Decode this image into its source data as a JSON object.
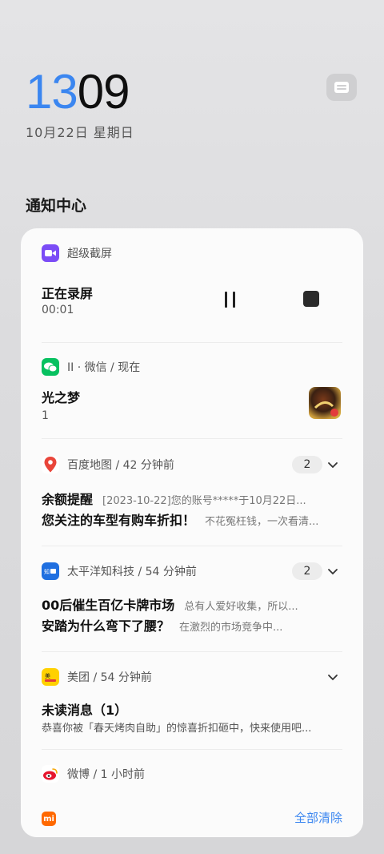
{
  "status": {
    "hour": "13",
    "minute": "09",
    "date": "10月22日 星期日"
  },
  "notification_center": {
    "title": "通知中心",
    "clear_all": "全部清除",
    "brand": "mi"
  },
  "screen_record": {
    "app": "超级截屏",
    "title": "正在录屏",
    "elapsed": "00:01"
  },
  "wechat": {
    "app": "II · 微信 / 现在",
    "title": "光之梦",
    "body": "1"
  },
  "baidu_map": {
    "app": "百度地图 / 42 分钟前",
    "count": "2",
    "items": [
      {
        "title": "余额提醒",
        "preview": "[2023-10-22]您的账号*****于10月22日..."
      },
      {
        "title": "您关注的车型有购车折扣！",
        "preview": "不花冤枉钱，一次看清..."
      }
    ]
  },
  "pconline": {
    "app": "太平洋知科技 / 54 分钟前",
    "count": "2",
    "items": [
      {
        "title": "00后催生百亿卡牌市场",
        "preview": "总有人爱好收集，所以..."
      },
      {
        "title": "安踏为什么弯下了腰？",
        "preview": "在激烈的市场竞争中..."
      }
    ]
  },
  "meituan": {
    "app": "美团 / 54 分钟前",
    "title": "未读消息（1）",
    "body": "恭喜你被「春天烤肉自助」的惊喜折扣砸中，快来使用吧..."
  },
  "weibo": {
    "app": "微博 / 1 小时前"
  },
  "colors": {
    "accent": "#3b86f0",
    "wechat_green": "#07c160",
    "record_purple": "#7b4cf6",
    "meituan_yellow": "#ffd100"
  }
}
